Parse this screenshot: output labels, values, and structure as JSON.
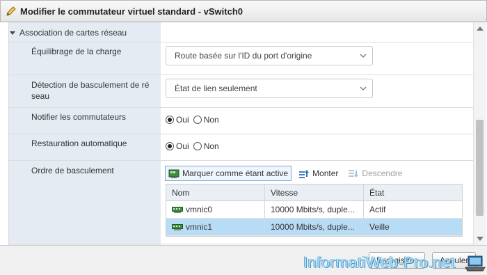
{
  "window": {
    "title": "Modifier le commutateur virtuel standard - vSwitch0"
  },
  "section": {
    "title": "Association de cartes réseau"
  },
  "rows": {
    "load_balancing": {
      "label": "Équilibrage de la charge",
      "value": "Route basée sur l'ID du port d'origine"
    },
    "failover_detection": {
      "label": "Détection de basculement de ré seau",
      "value": "État de lien seulement"
    },
    "notify_switches": {
      "label": "Notifier les commutateurs",
      "selected": "Oui",
      "options": [
        "Oui",
        "Non"
      ]
    },
    "failback": {
      "label": "Restauration automatique",
      "selected": "Oui",
      "options": [
        "Oui",
        "Non"
      ]
    },
    "failover_order": {
      "label": "Ordre de basculement"
    }
  },
  "toolbar": {
    "mark_active": "Marquer comme étant active",
    "move_up": "Monter",
    "move_down": "Descendre"
  },
  "grid": {
    "columns": [
      "Nom",
      "Vitesse",
      "État"
    ],
    "rows": [
      {
        "name": "vmnic0",
        "speed": "10000 Mbits/s, duple...",
        "state": "Actif",
        "selected": false
      },
      {
        "name": "vmnic1",
        "speed": "10000 Mbits/s, duple...",
        "state": "Veille",
        "selected": true
      }
    ]
  },
  "footer": {
    "save": "Enregistrer",
    "cancel": "Annuler"
  },
  "watermark": {
    "text": "InformatiWeb-Pro.net"
  },
  "colors": {
    "accent": "#2f6fb1",
    "selected_row": "#b8dcf5",
    "label_column": "#e4ebf3"
  }
}
